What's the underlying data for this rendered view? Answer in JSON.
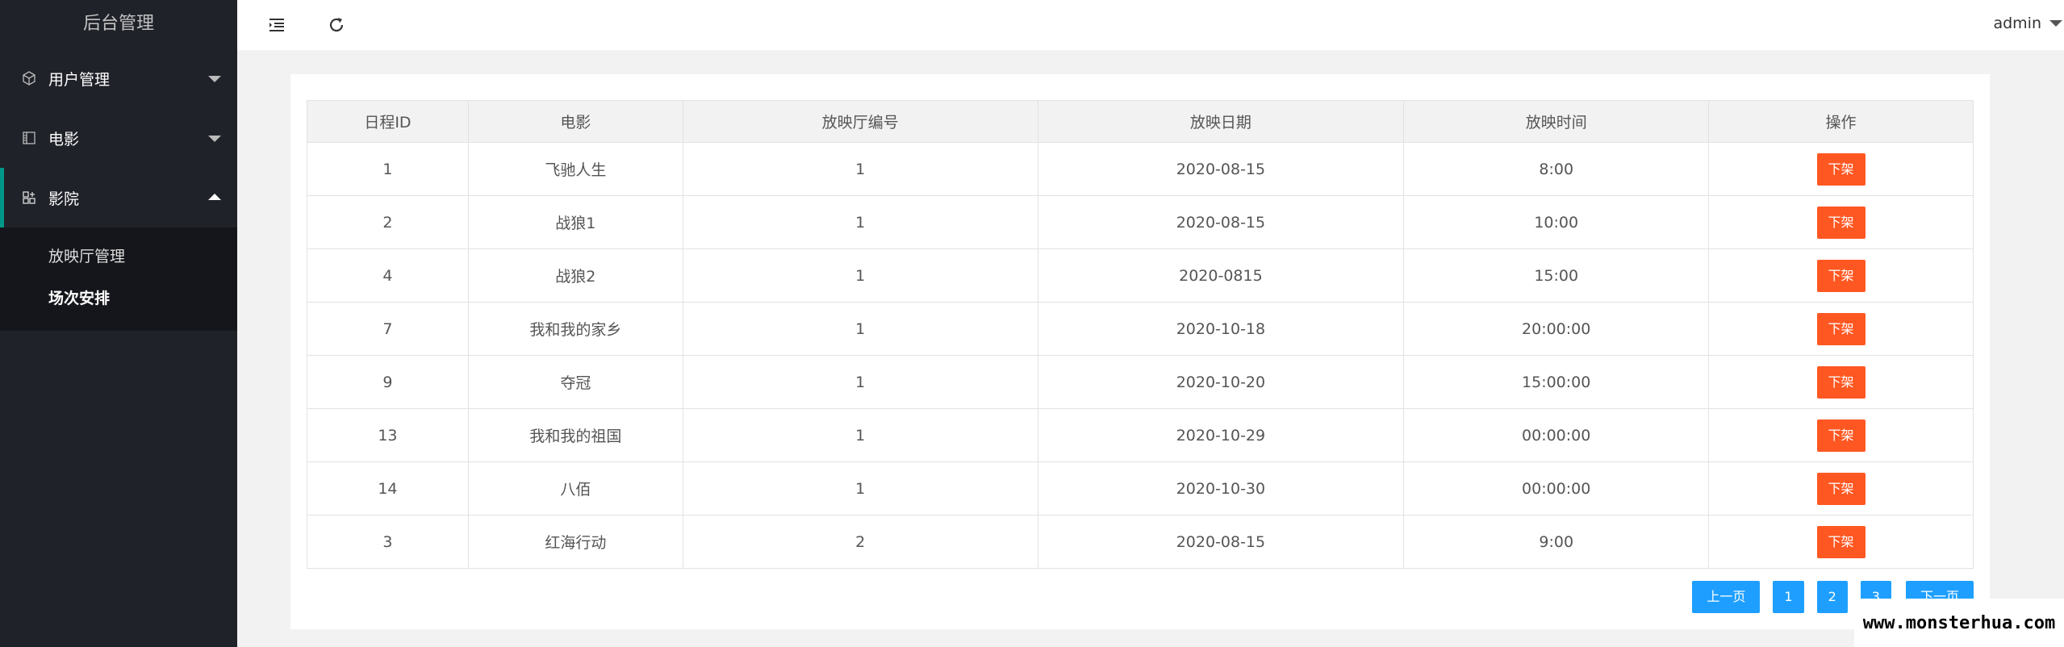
{
  "app_title": "后台管理",
  "sidebar": {
    "items": [
      {
        "label": "用户管理",
        "icon": "cube-icon",
        "expanded": false
      },
      {
        "label": "电影",
        "icon": "film-icon",
        "expanded": false
      },
      {
        "label": "影院",
        "icon": "apps-icon",
        "expanded": true
      }
    ],
    "submenu": [
      {
        "label": "放映厅管理",
        "current": false
      },
      {
        "label": "场次安排",
        "current": true
      }
    ]
  },
  "header": {
    "user": "admin"
  },
  "table": {
    "columns": [
      "日程ID",
      "电影",
      "放映厅编号",
      "放映日期",
      "放映时间",
      "操作"
    ],
    "rows": [
      {
        "id": "1",
        "movie": "飞驰人生",
        "hall": "1",
        "date": "2020-08-15",
        "time": "8:00",
        "action": "下架"
      },
      {
        "id": "2",
        "movie": "战狼1",
        "hall": "1",
        "date": "2020-08-15",
        "time": "10:00",
        "action": "下架"
      },
      {
        "id": "4",
        "movie": "战狼2",
        "hall": "1",
        "date": "2020-0815",
        "time": "15:00",
        "action": "下架"
      },
      {
        "id": "7",
        "movie": "我和我的家乡",
        "hall": "1",
        "date": "2020-10-18",
        "time": "20:00:00",
        "action": "下架"
      },
      {
        "id": "9",
        "movie": "夺冠",
        "hall": "1",
        "date": "2020-10-20",
        "time": "15:00:00",
        "action": "下架"
      },
      {
        "id": "13",
        "movie": "我和我的祖国",
        "hall": "1",
        "date": "2020-10-29",
        "time": "00:00:00",
        "action": "下架"
      },
      {
        "id": "14",
        "movie": "八佰",
        "hall": "1",
        "date": "2020-10-30",
        "time": "00:00:00",
        "action": "下架"
      },
      {
        "id": "3",
        "movie": "红海行动",
        "hall": "2",
        "date": "2020-08-15",
        "time": "9:00",
        "action": "下架"
      }
    ]
  },
  "pager": {
    "prev": "上一页",
    "pages": [
      "1",
      "2",
      "3"
    ],
    "next": "下一页"
  },
  "watermark": "www.monsterhua.com",
  "colors": {
    "sidebar_bg": "#20222a",
    "accent": "#009688",
    "danger": "#ff5722",
    "primary": "#1e9fff"
  }
}
